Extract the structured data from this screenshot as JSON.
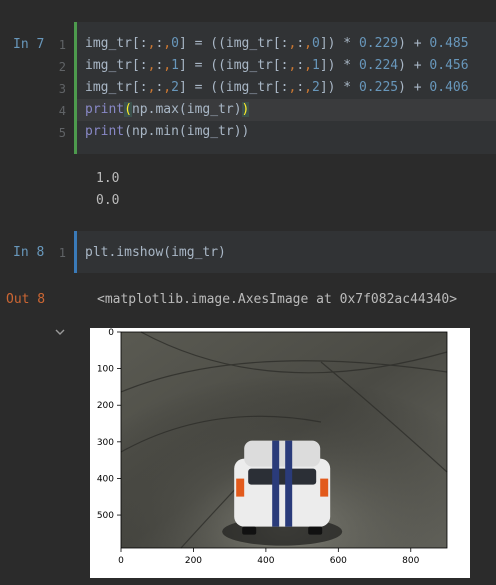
{
  "cells": [
    {
      "prompt": "In 7",
      "lines": [
        {
          "num": "1",
          "tokens": [
            {
              "t": "img_tr[:",
              "c": "tok-op"
            },
            {
              "t": ",",
              "c": "tok-comma"
            },
            {
              "t": ":",
              "c": "tok-op"
            },
            {
              "t": ",",
              "c": "tok-comma"
            },
            {
              "t": "0",
              "c": "tok-num"
            },
            {
              "t": "] = ((img_tr[:",
              "c": "tok-op"
            },
            {
              "t": ",",
              "c": "tok-comma"
            },
            {
              "t": ":",
              "c": "tok-op"
            },
            {
              "t": ",",
              "c": "tok-comma"
            },
            {
              "t": "0",
              "c": "tok-num"
            },
            {
              "t": "]) * ",
              "c": "tok-op"
            },
            {
              "t": "0.229",
              "c": "tok-num"
            },
            {
              "t": ") + ",
              "c": "tok-op"
            },
            {
              "t": "0.485",
              "c": "tok-num"
            }
          ]
        },
        {
          "num": "2",
          "tokens": [
            {
              "t": "img_tr[:",
              "c": "tok-op"
            },
            {
              "t": ",",
              "c": "tok-comma"
            },
            {
              "t": ":",
              "c": "tok-op"
            },
            {
              "t": ",",
              "c": "tok-comma"
            },
            {
              "t": "1",
              "c": "tok-num"
            },
            {
              "t": "] = ((img_tr[:",
              "c": "tok-op"
            },
            {
              "t": ",",
              "c": "tok-comma"
            },
            {
              "t": ":",
              "c": "tok-op"
            },
            {
              "t": ",",
              "c": "tok-comma"
            },
            {
              "t": "1",
              "c": "tok-num"
            },
            {
              "t": "]) * ",
              "c": "tok-op"
            },
            {
              "t": "0.224",
              "c": "tok-num"
            },
            {
              "t": ") + ",
              "c": "tok-op"
            },
            {
              "t": "0.456",
              "c": "tok-num"
            }
          ]
        },
        {
          "num": "3",
          "tokens": [
            {
              "t": "img_tr[:",
              "c": "tok-op"
            },
            {
              "t": ",",
              "c": "tok-comma"
            },
            {
              "t": ":",
              "c": "tok-op"
            },
            {
              "t": ",",
              "c": "tok-comma"
            },
            {
              "t": "2",
              "c": "tok-num"
            },
            {
              "t": "] = ((img_tr[:",
              "c": "tok-op"
            },
            {
              "t": ",",
              "c": "tok-comma"
            },
            {
              "t": ":",
              "c": "tok-op"
            },
            {
              "t": ",",
              "c": "tok-comma"
            },
            {
              "t": "2",
              "c": "tok-num"
            },
            {
              "t": "]) * ",
              "c": "tok-op"
            },
            {
              "t": "0.225",
              "c": "tok-num"
            },
            {
              "t": ") + ",
              "c": "tok-op"
            },
            {
              "t": "0.406",
              "c": "tok-num"
            }
          ]
        },
        {
          "num": "4",
          "current": true,
          "tokens": [
            {
              "t": "print",
              "c": "tok-bi"
            },
            {
              "t": "(",
              "c": "tok-hl"
            },
            {
              "t": "np.max(img_tr)",
              "c": "tok-op"
            },
            {
              "t": ")",
              "c": "tok-hl"
            }
          ]
        },
        {
          "num": "5",
          "tokens": [
            {
              "t": "print",
              "c": "tok-bi"
            },
            {
              "t": "(np.min(img_tr))",
              "c": "tok-op"
            }
          ]
        }
      ],
      "output": [
        "1.0",
        "0.0"
      ]
    },
    {
      "prompt": "In 8",
      "lines": [
        {
          "num": "1",
          "tokens": [
            {
              "t": "plt.imshow(img_tr)",
              "c": "tok-op"
            }
          ]
        }
      ],
      "out_prompt": "Out 8",
      "output": [
        "<matplotlib.image.AxesImage at 0x7f082ac44340>"
      ]
    }
  ],
  "icons": {
    "collapse": "chevron-down-icon"
  },
  "chart_data": {
    "type": "image",
    "xticks": [
      "0",
      "200",
      "400",
      "600",
      "800"
    ],
    "yticks": [
      "0",
      "100",
      "200",
      "300",
      "400",
      "500"
    ],
    "xlim": [
      0,
      900
    ],
    "ylim": [
      590,
      0
    ]
  }
}
